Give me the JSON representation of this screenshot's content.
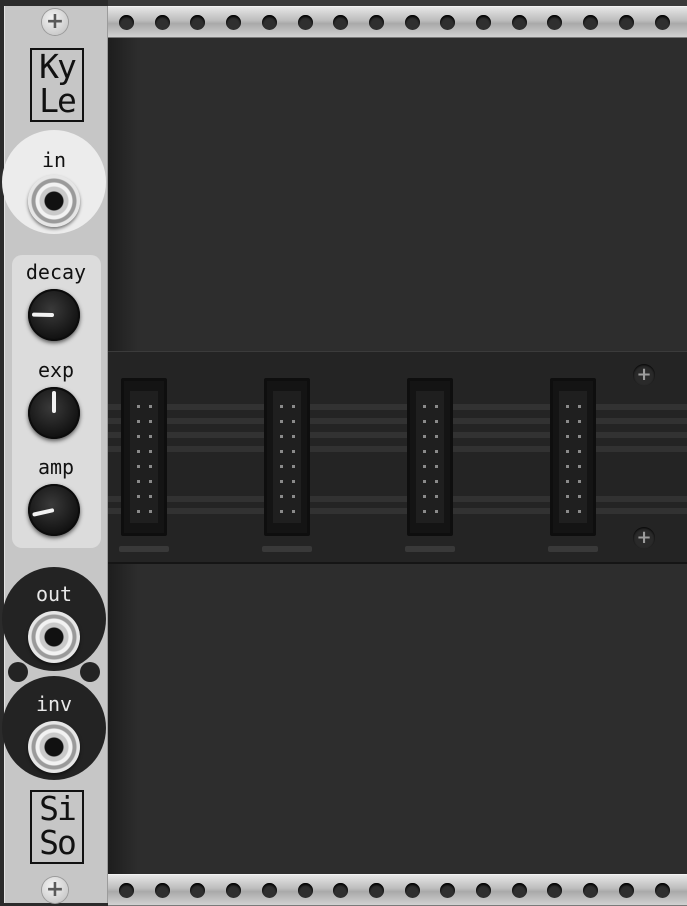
{
  "module": {
    "logo_top_line1": "Ky",
    "logo_top_line2": "Le",
    "logo_bottom_line1": "Si",
    "logo_bottom_line2": "So",
    "ports": {
      "in_label": "in",
      "out_label": "out",
      "inv_label": "inv"
    },
    "knobs": [
      {
        "label": "decay",
        "value_fraction": 0.17
      },
      {
        "label": "exp",
        "value_fraction": 0.5
      },
      {
        "label": "amp",
        "value_fraction": 0.12
      }
    ]
  },
  "rack": {
    "blank_plate_connectors": 4,
    "colors": {
      "panel": "#c6c6c6",
      "rack_background": "#2d2d2d",
      "rail": "#bdbdbd",
      "knob": "#111111",
      "port_background_dark": "#232323"
    }
  },
  "icons": {
    "screw": "screw-icon",
    "jack": "jack-socket-icon",
    "connector": "ribbon-connector-icon"
  }
}
